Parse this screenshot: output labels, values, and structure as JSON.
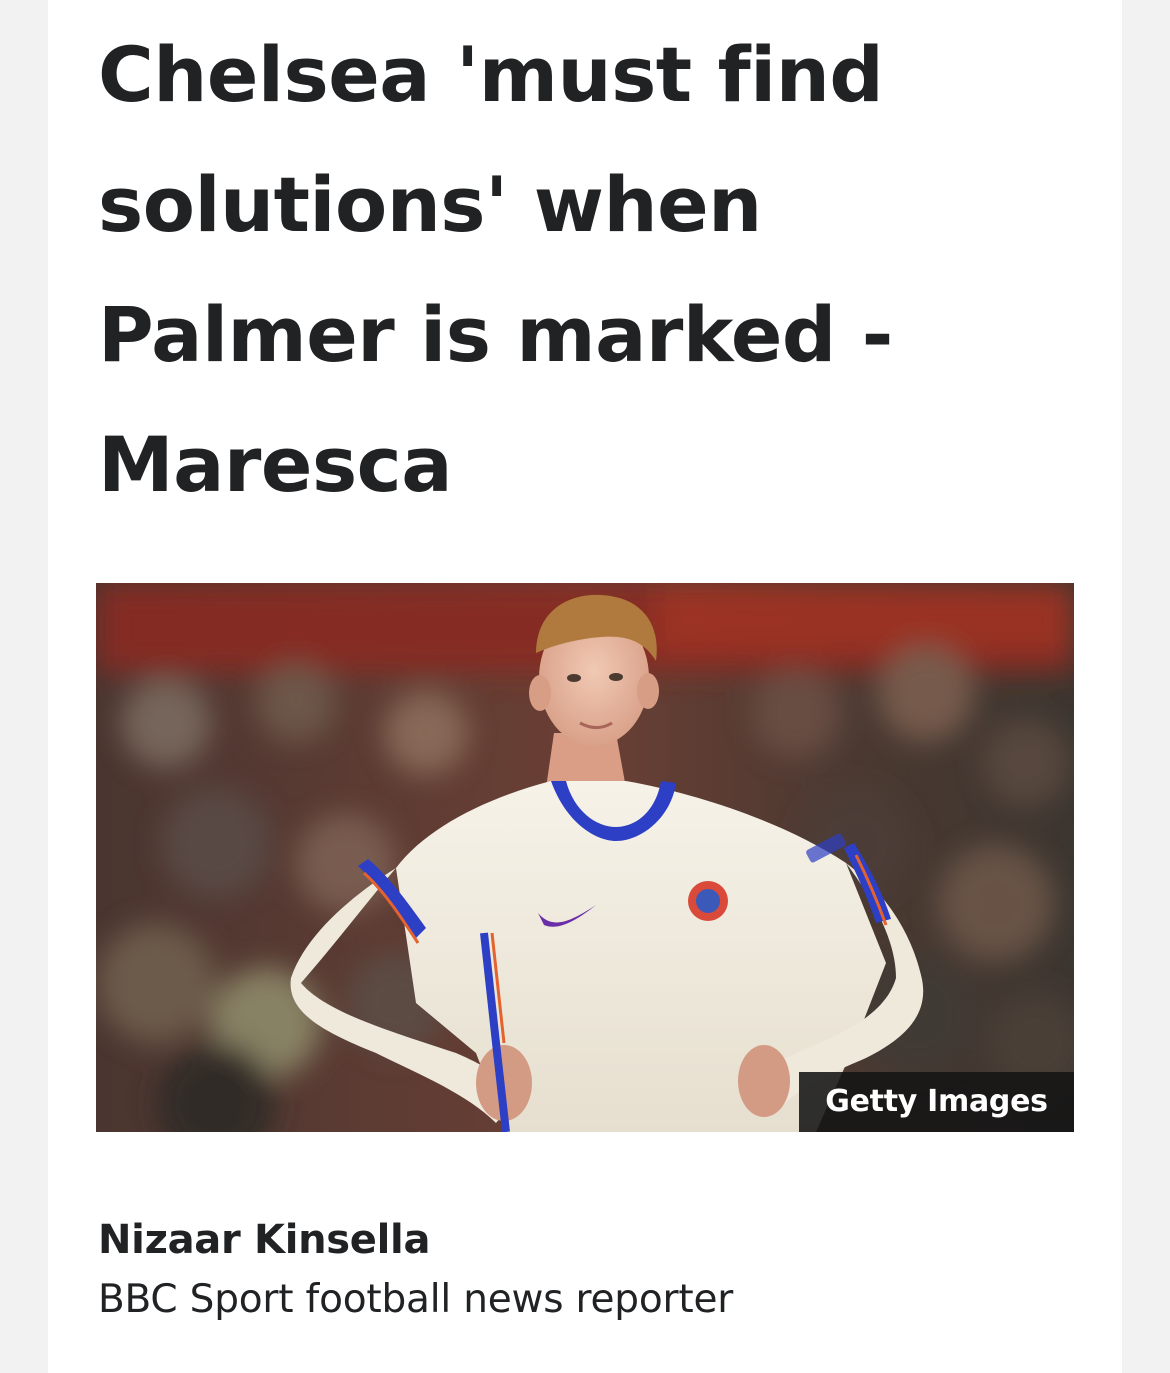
{
  "article": {
    "headline": "Chelsea 'must find solutions' when Palmer is marked - Maresca",
    "image": {
      "credit": "Getty Images",
      "icon": "player-photo"
    },
    "byline": {
      "author": "Nizaar Kinsella",
      "role": "BBC Sport football news reporter"
    }
  },
  "colors": {
    "page_background": "#f2f2f2",
    "article_background": "#ffffff",
    "text": "#202224",
    "credit_background": "#141414",
    "kit_white": "#f3eee2",
    "kit_blue": "#2d3fc4",
    "kit_orange": "#e4622f"
  }
}
